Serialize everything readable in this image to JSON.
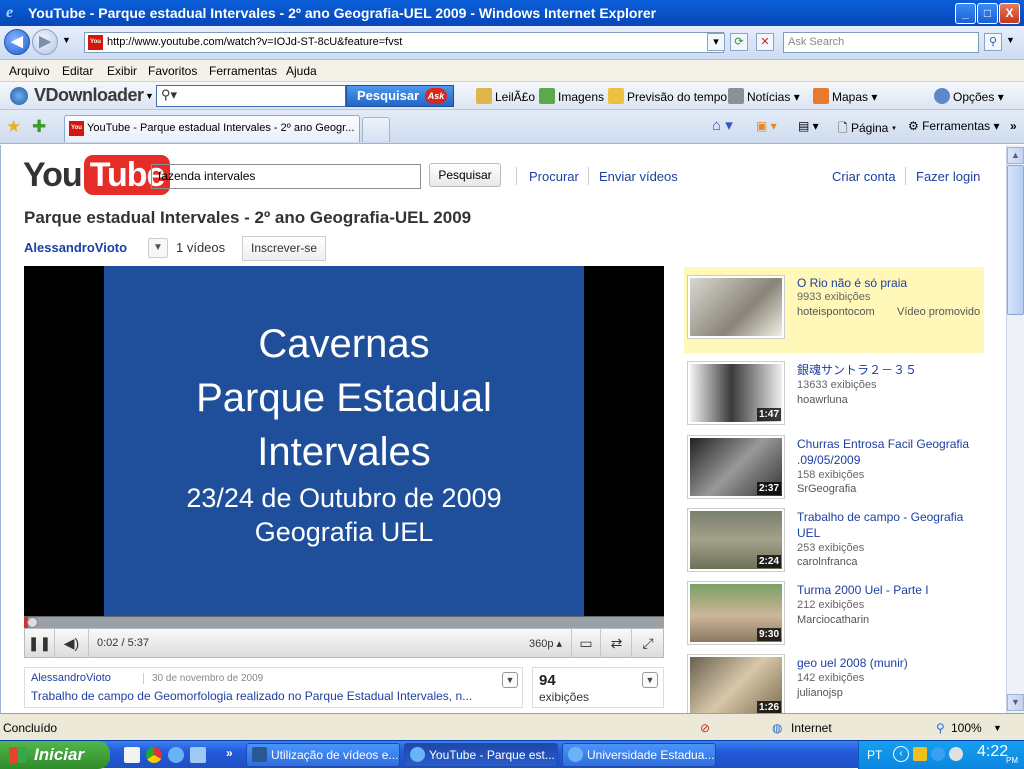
{
  "window": {
    "title": "YouTube - Parque estadual Intervales - 2º ano Geografia-UEL 2009 - Windows Internet Explorer",
    "minimize": "_",
    "maximize": "□",
    "close": "X"
  },
  "address_bar": {
    "url": "http://www.youtube.com/watch?v=IOJd-ST-8cU&feature=fvst",
    "search_placeholder": "Ask Search"
  },
  "menu": [
    "Arquivo",
    "Editar",
    "Exibir",
    "Favoritos",
    "Ferramentas",
    "Ajuda"
  ],
  "vdownloader": {
    "brand": "VDownloader",
    "search_button": "Pesquisar",
    "ask_badge": "Ask",
    "items": [
      "LeilÃ£o",
      "Imagens",
      "Previsão do tempo",
      "Notícias",
      "Mapas"
    ],
    "options": "Opções"
  },
  "tabs": {
    "active_label": "YouTube - Parque estadual Intervales - 2º ano Geogr...",
    "page_menu": "Página",
    "tools_menu": "Ferramentas"
  },
  "youtube": {
    "logo_you": "You",
    "logo_tube": "Tube",
    "search_value": "fazenda intervales",
    "search_button": "Pesquisar",
    "browse": "Procurar",
    "upload": "Enviar vídeos",
    "create_account": "Criar conta",
    "login": "Fazer login",
    "video_title": "Parque estadual Intervales - 2º ano Geografia-UEL 2009",
    "uploader": "AlessandroVioto",
    "video_count": "1 vídeos",
    "subscribe": "Inscrever-se",
    "slide": {
      "line1": "Cavernas",
      "line2": "Parque Estadual",
      "line3": "Intervales",
      "line4": "23/24 de Outubro de 2009",
      "line5": "Geografia UEL"
    },
    "player": {
      "time": "0:02 / 5:37",
      "quality": "360p",
      "progress": 0.006
    },
    "description": {
      "user": "AlessandroVioto",
      "date": "30 de novembro de 2009",
      "text": "Trabalho de campo de Geomorfologia realizado no Parque Estadual Intervales, n..."
    },
    "views": {
      "count": "94",
      "label": "exibições"
    },
    "related": [
      {
        "title": "O Rio não é só praia",
        "views": "9933 exibições",
        "channel": "hoteispontocom",
        "promo": "Vídeo promovido",
        "duration": ""
      },
      {
        "title": "銀魂サントラ２－３５",
        "views": "13633 exibições",
        "channel": "hoawrluna",
        "promo": "",
        "duration": "1:47"
      },
      {
        "title": "Churras Entrosa Facil Geografia .09/05/2009",
        "views": "158 exibições",
        "channel": "SrGeografia",
        "promo": "",
        "duration": "2:37"
      },
      {
        "title": "Trabalho de campo - Geografia UEL",
        "views": "253 exibições",
        "channel": "carolnfranca",
        "promo": "",
        "duration": "2:24"
      },
      {
        "title": "Turma 2000 Uel - Parte I",
        "views": "212 exibições",
        "channel": "Marciocatharin",
        "promo": "",
        "duration": "9:30"
      },
      {
        "title": "geo uel 2008 (munir)",
        "views": "142 exibições",
        "channel": "julianojsp",
        "promo": "",
        "duration": "1:26"
      }
    ]
  },
  "status": {
    "text": "Concluído",
    "zone": "Internet",
    "zoom": "100%"
  },
  "taskbar": {
    "start": "Iniciar",
    "buttons": [
      "Utilização de vídeos e...",
      "YouTube - Parque est...",
      "Universidade Estadua..."
    ],
    "lang": "PT",
    "clock": "4:22",
    "ampm": "PM"
  },
  "colors": {
    "yt_link": "#1c3fa2",
    "yt_red": "#e52d27",
    "slide_blue": "#1f4f9a",
    "promo_bg": "#fff8b8",
    "xp_blue": "#245ad8"
  }
}
